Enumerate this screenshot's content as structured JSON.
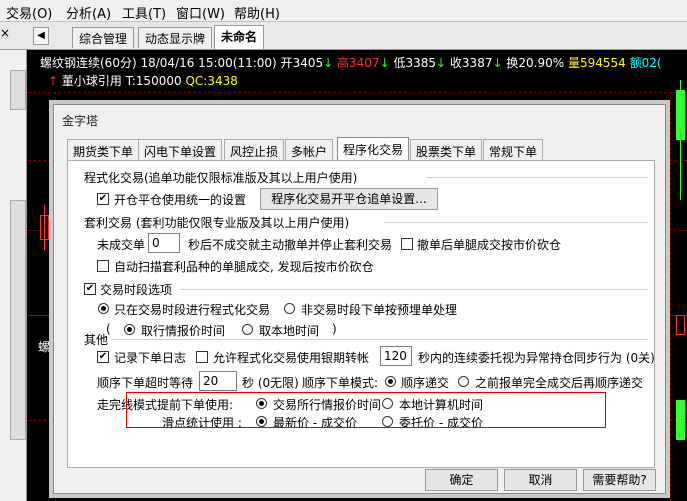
{
  "menubar": {
    "items": [
      "交易(O)",
      "分析(A)",
      "工具(T)",
      "窗口(W)",
      "帮助(H)"
    ]
  },
  "tabs": {
    "items": [
      "综合管理",
      "动态显示牌",
      "未命名"
    ],
    "back_arrow": "◀"
  },
  "quote": {
    "instrument": "螺纹钢连续(60分)",
    "datetime": "18/04/16 15:00(11:00)",
    "open_label": "开",
    "open": "3405",
    "high_label": "高",
    "high": "3407",
    "low_label": "低",
    "low": "3385",
    "close_label": "收",
    "close": "3387",
    "turnover_label": "换",
    "turnover": "20.90%",
    "volume_label": "量",
    "volume": "594554",
    "extra_label": "额",
    "extra": "02(",
    "signal": "董小球引用",
    "t_label": "T:",
    "t_value": "150000",
    "qc_label": "QC:",
    "qc_value": "3438",
    "side_label": "螺"
  },
  "colors": {
    "up": "#ff3030",
    "down": "#30ff30",
    "white": "#ffffff",
    "yellow": "#ffff00",
    "cyan": "#00ffff",
    "magenta": "#ff55ff",
    "grid": "#7a0000"
  },
  "dialog": {
    "title": "金字塔",
    "tabs": [
      "期货类下单",
      "闪电下单设置",
      "风控止损",
      "多帐户",
      "程序化交易",
      "股票类下单",
      "常规下单"
    ],
    "active_tab": "程序化交易",
    "sec1_title": "程式化交易(追单功能仅限标准版及其以上用户使用)",
    "sec1_cb": "开仓平仓使用统一的设置",
    "sec1_btn": "程序化交易开平仓追单设置...",
    "sec2_title": "套利交易 (套利功能仅限专业版及其以上用户使用)",
    "sec2_unfilled": "未成交单",
    "sec2_seconds": "0",
    "sec2_desc": "秒后不成交就主动撤单并停止套利交易",
    "sec2_cb_cancel": "撤单后单腿成交按市价砍仓",
    "sec2_cb_auto": "自动扫描套利品种的单腿成交, 发现后按市价砍仓",
    "sec3_cb": "交易时段选项",
    "sec3_r1": "只在交易时段进行程式化交易",
    "sec3_r2": "非交易时段下单按预埋单处理",
    "sec3_r3": "取行情报价时间",
    "sec3_r4": "取本地时间",
    "other_title": "其他",
    "other_cb_log": "记录下单日志",
    "other_cb_allow": "允许程式化交易使用银期转帐",
    "other_seconds": "120",
    "other_desc": "秒内的连续委托视为异常持仓同步行为 (0关)",
    "timeout_label": "顺序下单超时等待",
    "timeout_value": "20",
    "timeout_unit": "秒 (0无限)",
    "mode_label": "顺序下单模式:",
    "mode_r1": "顺序递交",
    "mode_r2": "之前报单完全成交后再顺序递交",
    "advance_label": "走完线模式提前下单使用:",
    "advance_r1": "交易所行情报价时间",
    "advance_r2": "本地计算机时间",
    "slip_label": "滑点统计使用 :",
    "slip_r1": "最新价 - 成交价",
    "slip_r2": "委托价 - 成交价",
    "ok": "确定",
    "cancel": "取消",
    "help": "需要帮助?"
  }
}
